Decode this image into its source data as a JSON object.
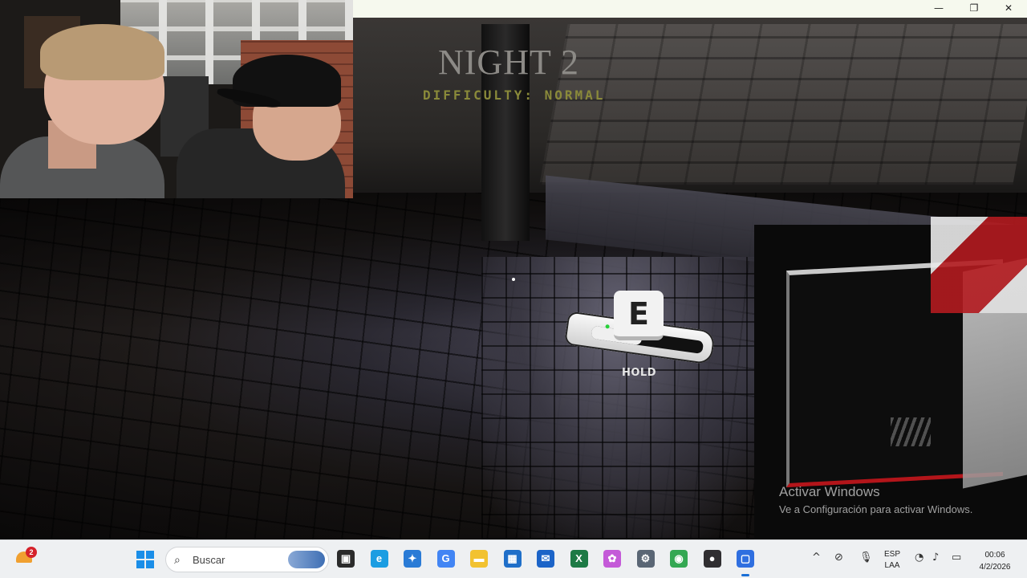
{
  "game": {
    "night_title": "NIGHT 2",
    "difficulty": "DIFFICULTY: NORMAL",
    "prompt": {
      "key": "E",
      "action": "HOLD",
      "hold_progress": 0.45
    }
  },
  "watermark": {
    "title": "Activar Windows",
    "subtitle": "Ve a Configuración para activar Windows."
  },
  "window_controls": {
    "minimize": "—",
    "restore": "❐",
    "close": "✕"
  },
  "taskbar": {
    "weather_badge": "2",
    "search_placeholder": "Buscar",
    "apps": [
      {
        "name": "task-view",
        "glyph": "▣",
        "color": "#2b2b2b"
      },
      {
        "name": "edge",
        "glyph": "e",
        "color": "#1b9de2"
      },
      {
        "name": "store-app",
        "glyph": "✦",
        "color": "#2a7bd6"
      },
      {
        "name": "google",
        "glyph": "G",
        "color": "#4285f4"
      },
      {
        "name": "file-explorer",
        "glyph": "▬",
        "color": "#f2c230"
      },
      {
        "name": "microsoft-store",
        "glyph": "▦",
        "color": "#1f6fc9"
      },
      {
        "name": "outlook",
        "glyph": "✉",
        "color": "#1c64c8"
      },
      {
        "name": "excel",
        "glyph": "X",
        "color": "#1d7a45"
      },
      {
        "name": "copilot",
        "glyph": "✿",
        "color": "#c45ad8"
      },
      {
        "name": "settings",
        "glyph": "⚙",
        "color": "#5a6675"
      },
      {
        "name": "chrome",
        "glyph": "◉",
        "color": "#34a853"
      },
      {
        "name": "obs",
        "glyph": "●",
        "color": "#302e31"
      },
      {
        "name": "active-app",
        "glyph": "▢",
        "color": "#2f6fe0"
      }
    ],
    "tray": {
      "chevron": "^",
      "language_line1": "ESP",
      "language_line2": "LAA",
      "time": "00:06",
      "date": "4/2/2026"
    }
  }
}
